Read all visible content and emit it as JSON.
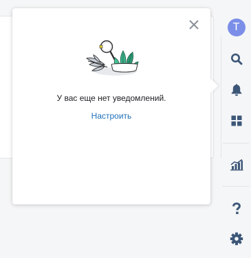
{
  "user": {
    "avatar_letter": "T"
  },
  "notifications": {
    "empty_message": "У вас еще нет уведомлений.",
    "setup_link": "Настроить"
  },
  "sidebar": {
    "items": [
      {
        "icon": "avatar"
      },
      {
        "icon": "search-icon"
      },
      {
        "icon": "bell-icon"
      },
      {
        "icon": "dashboard-grid-icon"
      },
      {
        "icon": "bar-chart-icon"
      },
      {
        "icon": "help-icon"
      },
      {
        "icon": "gear-icon"
      }
    ]
  },
  "colors": {
    "accent": "#5b6ee0",
    "icon": "#3d5778",
    "link": "#1e6fb8",
    "avatar": "#7b8fe8",
    "background": "#f5f6f7"
  }
}
